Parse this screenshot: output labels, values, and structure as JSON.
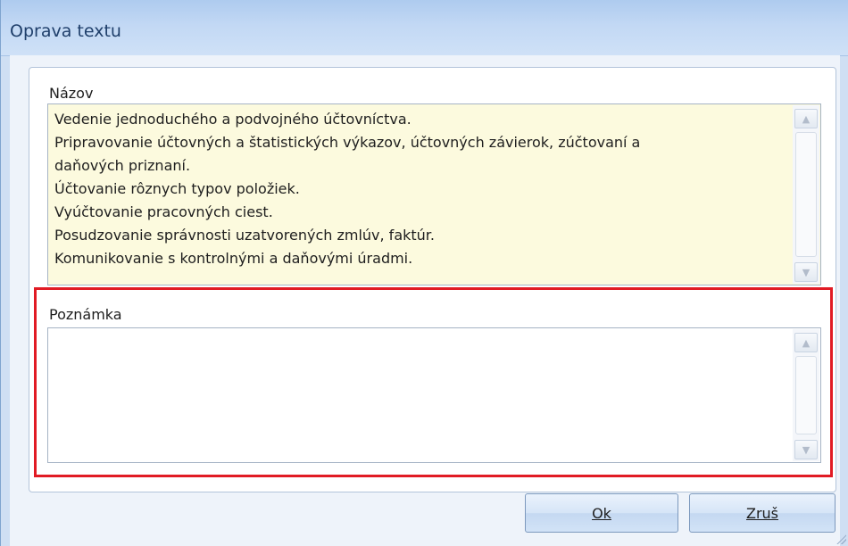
{
  "window": {
    "title": "Oprava textu"
  },
  "nazov": {
    "label": "Názov",
    "lines": [
      "Vedenie jednoduchého a podvojného účtovníctva.",
      "Pripravovanie účtovných a štatistických výkazov, účtovných závierok, zúčtovaní a",
      "daňových priznaní.",
      "Účtovanie rôznych typov položiek.",
      "Vyúčtovanie pracovných ciest.",
      "Posudzovanie správnosti uzatvorených zmlúv, faktúr.",
      "Komunikovanie s kontrolnými a daňovými úradmi."
    ]
  },
  "poznamka": {
    "label": "Poznámka",
    "value": ""
  },
  "buttons": {
    "ok": "Ok",
    "cancel": "Zruš"
  },
  "colors": {
    "highlight": "#e11b24",
    "nazov_background": "#fcfade"
  }
}
